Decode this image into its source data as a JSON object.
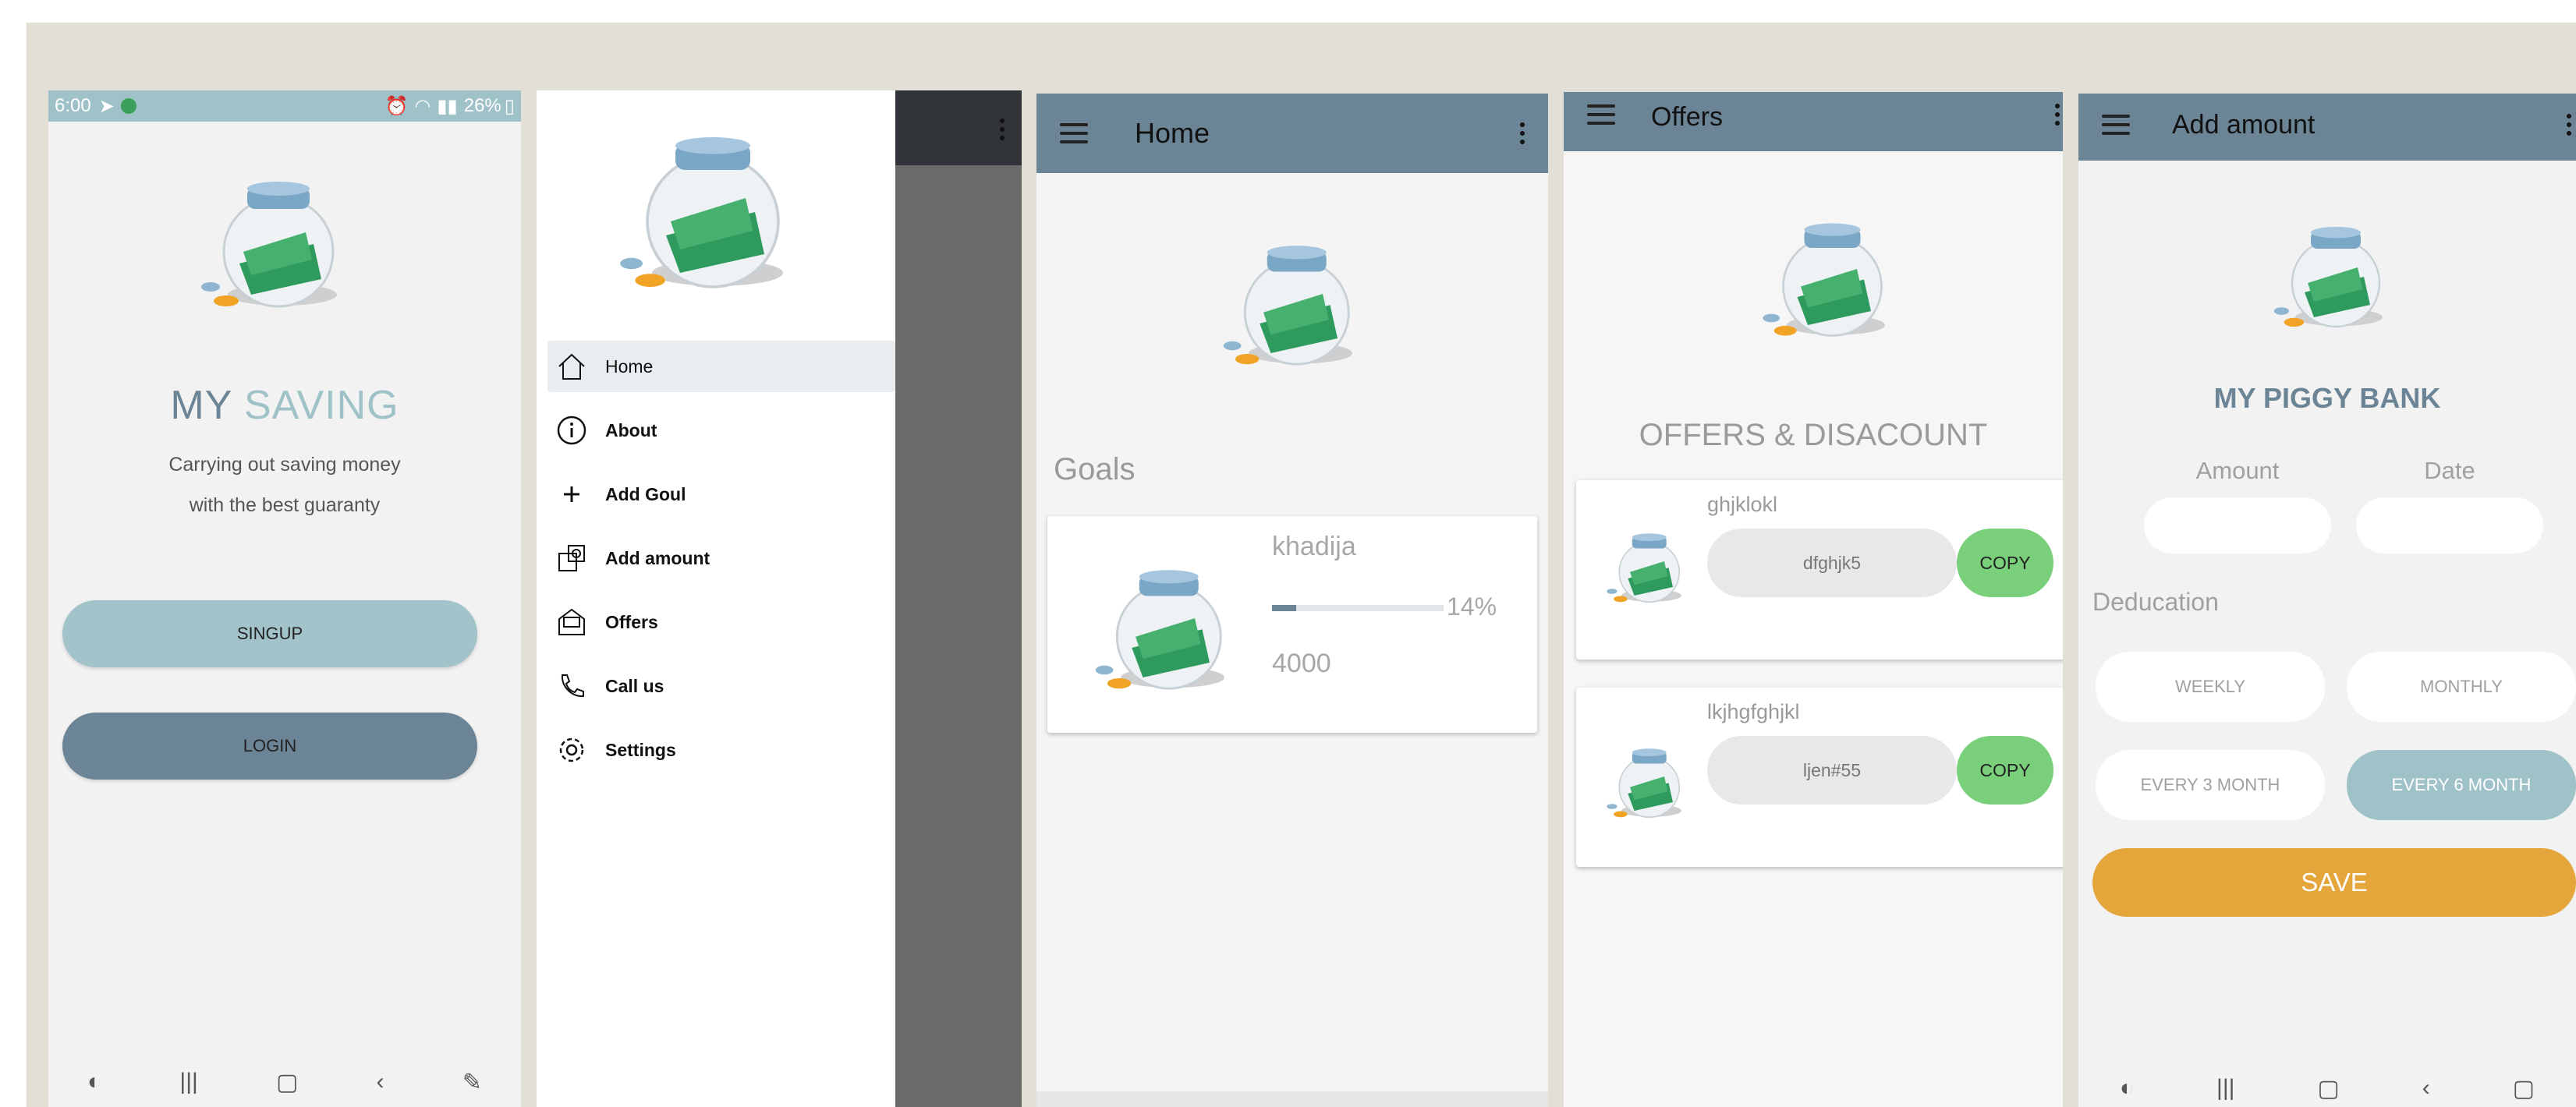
{
  "screen1": {
    "status": {
      "time": "6:00",
      "right": "26%"
    },
    "app_title_part1": "MY",
    "app_title_part2": "SAVING",
    "tagline_line1": "Carrying out saving money",
    "tagline_line2": "with the best guaranty",
    "signup_label": "SINGUP",
    "login_label": "LOGIN"
  },
  "drawer": {
    "items": [
      {
        "label": "Home",
        "icon": "home-icon"
      },
      {
        "label": "About",
        "icon": "info-icon"
      },
      {
        "label": "Add Goul",
        "icon": "plus-icon"
      },
      {
        "label": "Add amount",
        "icon": "money-icon"
      },
      {
        "label": "Offers",
        "icon": "offer-icon"
      },
      {
        "label": "Call us",
        "icon": "phone-icon"
      },
      {
        "label": "Settings",
        "icon": "gear-icon"
      }
    ]
  },
  "home": {
    "title": "Home",
    "section_title": "Goals",
    "goal": {
      "name": "khadija",
      "progress_label": "14%",
      "progress": 0.14,
      "amount": "4000"
    }
  },
  "offers": {
    "title": "Offers",
    "heading": "OFFERS & DISACOUNT",
    "items": [
      {
        "name": "ghjklokl",
        "code": "dfghjk5",
        "copy_label": "COPY"
      },
      {
        "name": "lkjhgfghjkl",
        "code": "ljen#55",
        "copy_label": "COPY"
      }
    ]
  },
  "add_amount": {
    "title": "Add amount",
    "heading": "MY PIGGY BANK",
    "amount_label": "Amount",
    "date_label": "Date",
    "amount_value": "",
    "date_value": "",
    "deduction_label": "Deducation",
    "options": [
      "WEEKLY",
      "MONTHLY",
      "EVERY 3 MONTH",
      "EVERY 6 MONTH"
    ],
    "selected_option": "EVERY 6 MONTH",
    "save_label": "SAVE"
  },
  "colors": {
    "primary": "#6b8596",
    "accent_teal": "#9fc1c8",
    "copy_green": "#79cf7a",
    "save_orange": "#e4a53b"
  }
}
